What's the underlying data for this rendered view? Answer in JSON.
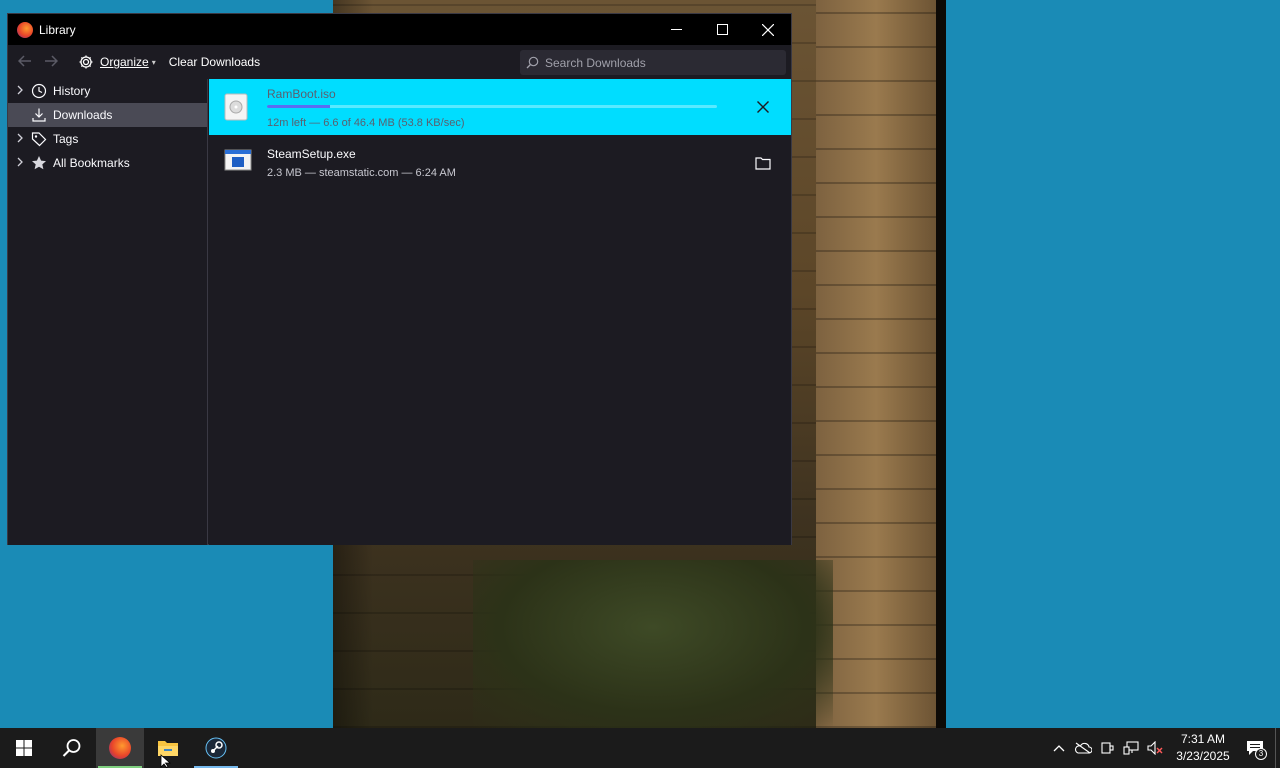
{
  "window": {
    "title": "Library",
    "controls": {
      "minimize": "—",
      "maximize": "☐",
      "close": "✕"
    }
  },
  "toolbar": {
    "back_icon": "arrow-left-icon",
    "forward_icon": "arrow-right-icon",
    "organize_label": "Organize",
    "clear_label": "Clear Downloads",
    "search_placeholder": "Search Downloads"
  },
  "sidebar": {
    "items": [
      {
        "label": "History",
        "icon": "clock-icon",
        "expandable": true,
        "selected": false
      },
      {
        "label": "Downloads",
        "icon": "download-icon",
        "expandable": false,
        "selected": true
      },
      {
        "label": "Tags",
        "icon": "tag-icon",
        "expandable": true,
        "selected": false
      },
      {
        "label": "All Bookmarks",
        "icon": "star-icon",
        "expandable": true,
        "selected": false
      }
    ]
  },
  "downloads": [
    {
      "name": "RamBoot.iso",
      "status": "12m left — 6.6 of 46.4 MB (53.8 KB/sec)",
      "progress_fraction": 0.14,
      "active": true,
      "action_icon": "cancel-icon"
    },
    {
      "name": "SteamSetup.exe",
      "status": "2.3 MB — steamstatic.com — 6:24 AM",
      "active": false,
      "action_icon": "folder-icon"
    }
  ],
  "taskbar": {
    "apps": [
      "start-icon",
      "search-icon",
      "firefox-icon",
      "file-explorer-icon",
      "steam-icon"
    ],
    "clock": {
      "time": "7:31 AM",
      "date": "3/23/2025"
    },
    "notifications_count": "3"
  },
  "colors": {
    "accent": "#00ddff",
    "progress": "#5a6df2",
    "desktop": "#1a8bb6"
  }
}
